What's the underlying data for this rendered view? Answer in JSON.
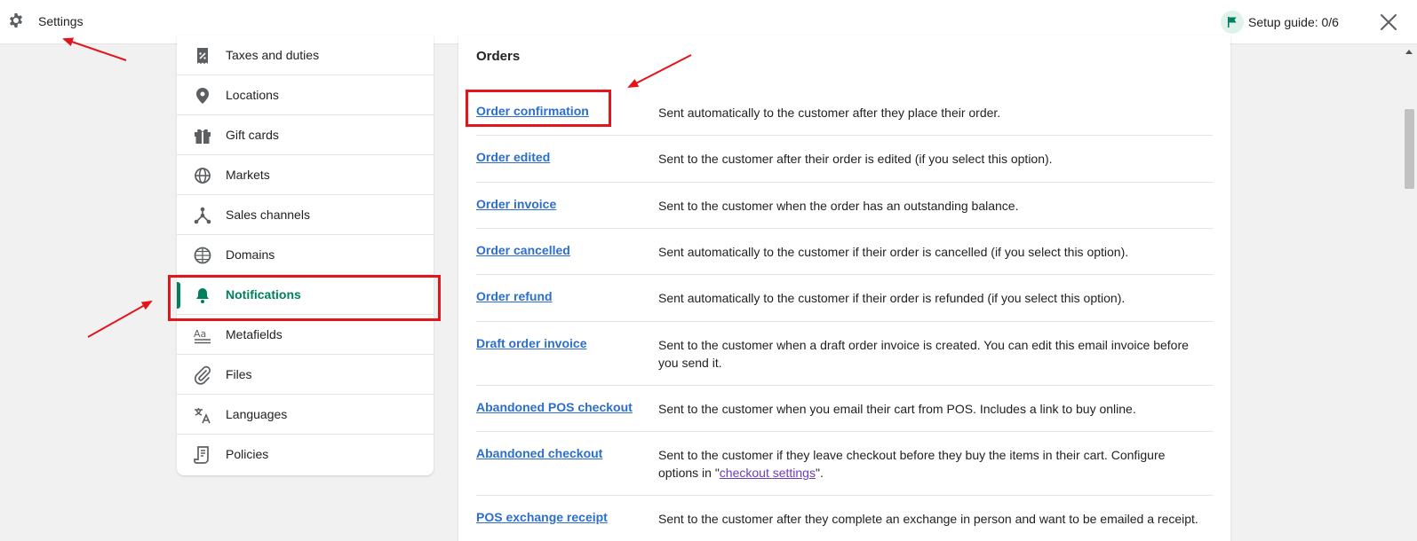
{
  "header": {
    "title": "Settings",
    "setup_guide": "Setup guide: 0/6",
    "icons": {
      "gear": "gear-icon",
      "flag": "flag-icon",
      "close": "close-icon"
    }
  },
  "sidebar": {
    "items": [
      {
        "label": "Taxes and duties",
        "icon": "receipt-icon"
      },
      {
        "label": "Locations",
        "icon": "location-pin-icon"
      },
      {
        "label": "Gift cards",
        "icon": "gift-icon"
      },
      {
        "label": "Markets",
        "icon": "globe-icon"
      },
      {
        "label": "Sales channels",
        "icon": "network-icon"
      },
      {
        "label": "Domains",
        "icon": "globe-grid-icon"
      },
      {
        "label": "Notifications",
        "icon": "bell-icon",
        "active": true
      },
      {
        "label": "Metafields",
        "icon": "metafields-icon"
      },
      {
        "label": "Files",
        "icon": "paperclip-icon"
      },
      {
        "label": "Languages",
        "icon": "translate-icon"
      },
      {
        "label": "Policies",
        "icon": "policy-document-icon"
      }
    ]
  },
  "orders": {
    "heading": "Orders",
    "rows": [
      {
        "link": "Order confirmation",
        "desc": "Sent automatically to the customer after they place their order."
      },
      {
        "link": "Order edited",
        "desc": "Sent to the customer after their order is edited (if you select this option)."
      },
      {
        "link": "Order invoice",
        "desc": "Sent to the customer when the order has an outstanding balance."
      },
      {
        "link": "Order cancelled",
        "desc": "Sent automatically to the customer if their order is cancelled (if you select this option)."
      },
      {
        "link": "Order refund",
        "desc": "Sent automatically to the customer if their order is refunded (if you select this option)."
      },
      {
        "link": "Draft order invoice",
        "desc": "Sent to the customer when a draft order invoice is created. You can edit this email invoice before you send it."
      },
      {
        "link": "Abandoned POS checkout",
        "desc": "Sent to the customer when you email their cart from POS. Includes a link to buy online."
      },
      {
        "link": "Abandoned checkout",
        "desc_before": "Sent to the customer if they leave checkout before they buy the items in their cart. Configure options in \"",
        "desc_link": "checkout settings",
        "desc_after": "\"."
      },
      {
        "link": "POS exchange receipt",
        "desc": "Sent to the customer after they complete an exchange in person and want to be emailed a receipt."
      }
    ]
  },
  "colors": {
    "accent_green": "#007f5f",
    "link_blue": "#2c6ecb",
    "annotation_red": "#e3151b"
  }
}
